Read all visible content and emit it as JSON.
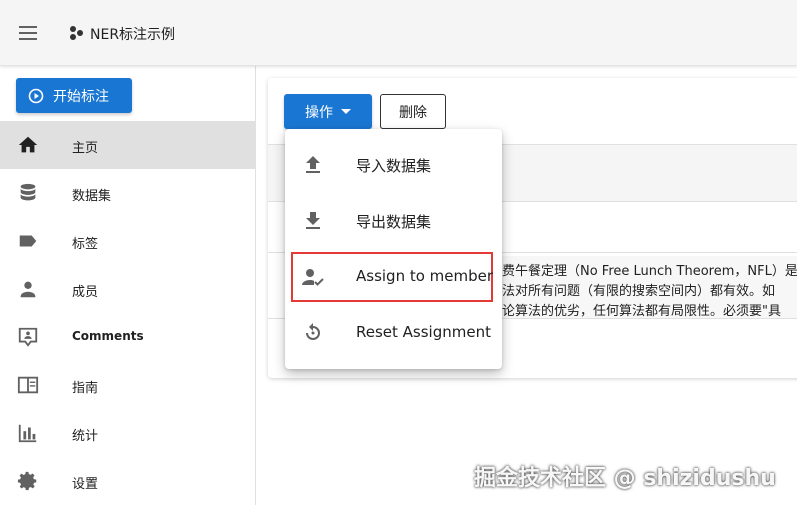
{
  "appbar": {
    "title": "NER标注示例"
  },
  "sidebar": {
    "start_button": "开始标注",
    "items": [
      {
        "label": "主页",
        "icon": "home-icon",
        "active": true
      },
      {
        "label": "数据集",
        "icon": "database-icon"
      },
      {
        "label": "标签",
        "icon": "label-icon"
      },
      {
        "label": "成员",
        "icon": "person-icon"
      },
      {
        "label": "Comments",
        "icon": "comment-icon"
      },
      {
        "label": "指南",
        "icon": "book-icon"
      },
      {
        "label": "统计",
        "icon": "chart-icon"
      },
      {
        "label": "设置",
        "icon": "gear-icon"
      }
    ]
  },
  "toolbar": {
    "actions_label": "操作",
    "delete_label": "删除"
  },
  "table": {
    "row_lines": [
      "费午餐定理（No Free Lunch Theorem，NFL）是",
      "法对所有问题（有限的搜索空间内）都有效。如",
      "论算法的优劣，任何算法都有局限性。必须要\"具"
    ]
  },
  "dropdown": {
    "items": [
      {
        "label": "导入数据集",
        "icon": "upload-icon"
      },
      {
        "label": "导出数据集",
        "icon": "download-icon"
      },
      {
        "label": "Assign to member",
        "icon": "person-check-icon",
        "highlighted": true
      },
      {
        "label": "Reset Assignment",
        "icon": "reset-icon"
      }
    ]
  },
  "watermark": "掘金技术社区 @ shizidushu",
  "colors": {
    "primary": "#1976d2",
    "highlight": "#e53935"
  }
}
